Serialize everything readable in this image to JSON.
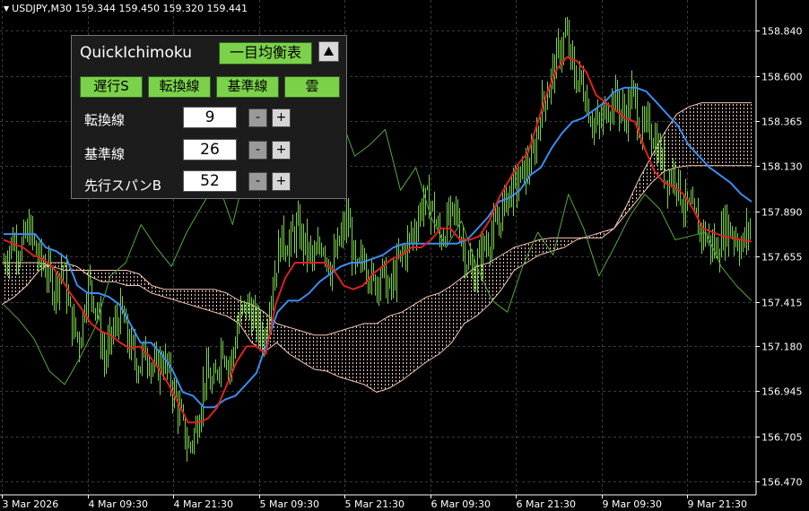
{
  "window": {
    "symbol_title": "USDJPY,M30  159.344 159.450 159.320 159.441"
  },
  "chart_data": {
    "type": "candlestick",
    "symbol": "USDJPY",
    "timeframe": "M30",
    "ohlc_header": {
      "open": 159.344,
      "high": 159.45,
      "low": 159.32,
      "close": 159.441
    },
    "price_ticks": [
      "158.840",
      "158.600",
      "158.365",
      "158.130",
      "157.890",
      "157.655",
      "157.415",
      "157.180",
      "156.945",
      "156.705",
      "156.470"
    ],
    "time_ticks": [
      "3 Mar 2026",
      "4 Mar 09:30",
      "4 Mar 21:30",
      "5 Mar 09:30",
      "5 Mar 21:30",
      "6 Mar 09:30",
      "6 Mar 21:30",
      "9 Mar 09:30",
      "9 Mar 21:30"
    ],
    "ylim": [
      156.4,
      159.0
    ],
    "grid": true,
    "colors": {
      "background": "#000000",
      "grid": "#3a3a3a",
      "candle": "#7cd14a",
      "tenkan": "#e02020",
      "kijun": "#3c8cf0",
      "chikou": "#54a83a",
      "kumo": "#f2c8b8",
      "axis_text": "#ffffff"
    },
    "price_path": [
      157.62,
      157.74,
      157.69,
      157.8,
      157.65,
      157.59,
      157.48,
      157.62,
      157.31,
      157.21,
      157.52,
      157.4,
      157.1,
      157.26,
      157.36,
      157.18,
      157.08,
      157.16,
      157.05,
      157.12,
      156.98,
      156.82,
      156.64,
      156.76,
      157.03,
      156.96,
      157.2,
      157.06,
      157.32,
      157.4,
      157.3,
      157.22,
      157.5,
      157.74,
      157.72,
      157.8,
      157.7,
      157.62,
      157.74,
      157.58,
      157.72,
      157.86,
      157.55,
      157.66,
      157.5,
      157.58,
      157.46,
      157.62,
      157.7,
      157.8,
      157.95,
      157.92,
      157.74,
      157.84,
      157.88,
      157.66,
      157.55,
      157.68,
      157.76,
      157.83,
      157.98,
      158.02,
      158.1,
      158.15,
      158.42,
      158.55,
      158.7,
      158.82,
      158.6,
      158.56,
      158.38,
      158.33,
      158.45,
      158.48,
      158.38,
      158.52,
      158.3,
      158.34,
      158.22,
      158.06,
      158.1,
      157.93,
      157.88,
      157.8,
      157.74,
      157.68,
      157.82,
      157.78,
      157.7,
      157.82
    ],
    "tenkan": [
      157.74,
      157.72,
      157.7,
      157.66,
      157.64,
      157.6,
      157.53,
      157.45,
      157.38,
      157.3,
      157.26,
      157.24,
      157.2,
      157.17,
      157.18,
      157.13,
      157.06,
      156.98,
      156.88,
      156.78,
      156.78,
      156.8,
      156.86,
      156.98,
      157.1,
      157.18,
      157.18,
      157.14,
      157.4,
      157.54,
      157.62,
      157.62,
      157.62,
      157.62,
      157.58,
      157.5,
      157.48,
      157.5,
      157.56,
      157.6,
      157.64,
      157.66,
      157.7,
      157.7,
      157.74,
      157.8,
      157.8,
      157.74,
      157.74,
      157.76,
      157.84,
      157.96,
      158.05,
      158.14,
      158.2,
      158.36,
      158.52,
      158.64,
      158.7,
      158.68,
      158.62,
      158.5,
      158.46,
      158.42,
      158.38,
      158.36,
      158.22,
      158.1,
      158.04,
      158.02,
      157.98,
      157.9,
      157.8,
      157.78,
      157.76,
      157.75,
      157.74,
      157.73
    ],
    "kijun": [
      157.77,
      157.77,
      157.77,
      157.77,
      157.7,
      157.68,
      157.64,
      157.5,
      157.46,
      157.46,
      157.44,
      157.4,
      157.3,
      157.2,
      157.2,
      157.14,
      157.06,
      156.94,
      156.92,
      156.86,
      156.86,
      156.9,
      156.92,
      156.98,
      157.04,
      157.2,
      157.36,
      157.42,
      157.42,
      157.46,
      157.52,
      157.56,
      157.6,
      157.62,
      157.62,
      157.64,
      157.66,
      157.7,
      157.72,
      157.72,
      157.72,
      157.72,
      157.72,
      157.72,
      157.74,
      157.8,
      157.86,
      157.94,
      157.96,
      158.0,
      158.08,
      158.12,
      158.22,
      158.3,
      158.36,
      158.38,
      158.42,
      158.46,
      158.52,
      158.54,
      158.54,
      158.52,
      158.46,
      158.4,
      158.34,
      158.24,
      158.18,
      158.12,
      158.08,
      158.04,
      157.98,
      157.94
    ],
    "chikou": [
      157.4,
      157.32,
      157.22,
      157.05,
      156.98,
      157.12,
      157.28,
      157.55,
      157.62,
      157.82,
      157.7,
      157.6,
      157.78,
      157.92,
      158.05,
      157.82,
      158.15,
      158.6,
      158.66,
      158.35,
      158.1,
      158.62,
      158.4,
      158.18,
      158.24,
      158.32,
      158.0,
      158.12,
      157.86,
      157.7,
      157.84,
      157.6,
      157.42,
      157.36,
      157.6,
      157.78,
      157.66,
      157.98,
      157.8,
      157.55,
      157.7,
      157.86,
      157.98,
      157.9,
      157.74,
      157.76,
      157.78,
      157.6,
      157.5,
      157.42
    ],
    "kumo_span_a": [
      157.4,
      157.44,
      157.5,
      157.58,
      157.62,
      157.62,
      157.6,
      157.55,
      157.52,
      157.52,
      157.5,
      157.5,
      157.46,
      157.44,
      157.42,
      157.4,
      157.38,
      157.36,
      157.34,
      157.3,
      157.2,
      157.15,
      157.2,
      157.14,
      157.1,
      157.06,
      157.05,
      157.02,
      157.0,
      156.98,
      156.94,
      156.96,
      157.0,
      157.05,
      157.1,
      157.14,
      157.2,
      157.3,
      157.34,
      157.4,
      157.48,
      157.58,
      157.62,
      157.66,
      157.68,
      157.7,
      157.74,
      157.76,
      157.78,
      157.8,
      157.88,
      157.96,
      158.04,
      158.1,
      158.12,
      158.13,
      158.13,
      158.13,
      158.13,
      158.13,
      158.13
    ],
    "kumo_span_b": [
      157.62,
      157.62,
      157.62,
      157.62,
      157.6,
      157.58,
      157.58,
      157.58,
      157.58,
      157.58,
      157.58,
      157.56,
      157.5,
      157.48,
      157.48,
      157.48,
      157.48,
      157.48,
      157.46,
      157.42,
      157.4,
      157.36,
      157.3,
      157.28,
      157.26,
      157.24,
      157.24,
      157.26,
      157.28,
      157.3,
      157.3,
      157.34,
      157.36,
      157.4,
      157.44,
      157.46,
      157.5,
      157.55,
      157.6,
      157.62,
      157.66,
      157.7,
      157.72,
      157.74,
      157.75,
      157.75,
      157.75,
      157.75,
      157.75,
      157.8,
      157.92,
      158.06,
      158.18,
      158.3,
      158.4,
      158.44,
      158.46,
      158.46,
      158.46,
      158.46,
      158.46
    ]
  },
  "panel": {
    "title": "QuickIchimoku",
    "ichimoku_button": "一目均衡表",
    "collapse_icon": "up-triangle",
    "toggles": [
      {
        "label": "遅行S"
      },
      {
        "label": "転換線"
      },
      {
        "label": "基準線"
      },
      {
        "label": "雲"
      }
    ],
    "params": [
      {
        "label": "転換線",
        "value": "9",
        "minus": "-",
        "plus": "+"
      },
      {
        "label": "基準線",
        "value": "26",
        "minus": "-",
        "plus": "+"
      },
      {
        "label": "先行スパンB",
        "value": "52",
        "minus": "-",
        "plus": "+"
      }
    ]
  }
}
